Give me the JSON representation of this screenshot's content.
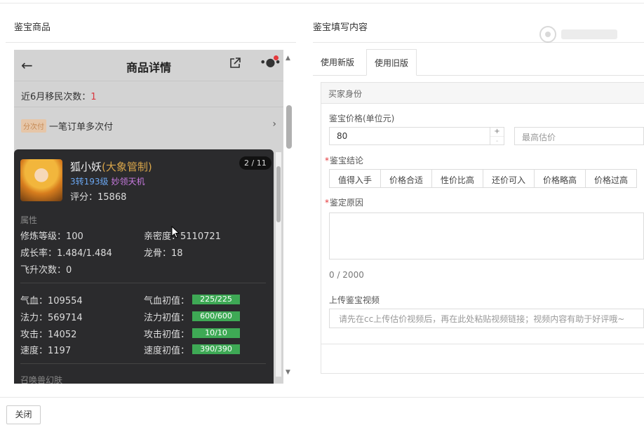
{
  "left_section_title": "鉴宝商品",
  "right_section_title": "鉴宝填写内容",
  "phone": {
    "title": "商品详情",
    "migration_label": "近6月移民次数：",
    "migration_count": "1",
    "installment_badge": "分次付",
    "installment_text": "一笔订单多次付",
    "pet": {
      "name": "狐小妖",
      "tag": "(大象管制)",
      "level": "3转193级",
      "skill": "妙领天机",
      "score": "评分：15868",
      "pager": "2 / 11",
      "attr_section": "属性",
      "cultivation": "修炼等级：100",
      "intimacy": "亲密度：5110721",
      "growth": "成长率：1.484/1.484",
      "dragon_bone": "龙骨：18",
      "ascension": "飞升次数：0",
      "hp": "气血：109554",
      "hp_init_label": "气血初值：",
      "hp_init_value": "225/225",
      "mp": "法力：569714",
      "mp_init_label": "法力初值：",
      "mp_init_value": "600/600",
      "atk": "攻击：14052",
      "atk_init_label": "攻击初值：",
      "atk_init_value": "10/10",
      "spd": "速度：1197",
      "spd_init_label": "速度初值：",
      "spd_init_value": "390/390",
      "next_section": "召唤兽幻肤"
    }
  },
  "tabs": [
    {
      "label": "使用新版",
      "active": false
    },
    {
      "label": "使用旧版",
      "active": true
    }
  ],
  "form": {
    "header": "买家身份",
    "price_label": "鉴宝价格(单位元)",
    "price_value": "80",
    "max_estimate_placeholder": "最高估价",
    "conclusion_label": "鉴宝结论",
    "conclusions": [
      "值得入手",
      "价格合适",
      "性价比高",
      "还价可入",
      "价格略高",
      "价格过高"
    ],
    "reason_label": "鉴定原因",
    "reason_counter": "0 / 2000",
    "video_label": "上传鉴宝视频",
    "video_placeholder": "请先在cc上传估价视频后，再在此处粘贴视频链接；视频内容有助于好评哦~"
  },
  "footer": {
    "close_label": "关闭"
  },
  "colors": {
    "accent_red": "#e4393c",
    "green_bar": "#3ea955",
    "card_bg": "#2b2b2d",
    "level_blue": "#6aa6f0",
    "skill_purple": "#c77adf",
    "tag_gold": "#d8a54a"
  }
}
